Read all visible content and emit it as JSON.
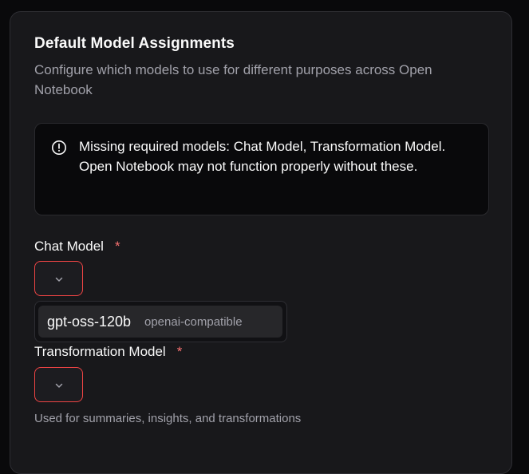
{
  "card": {
    "title": "Default Model Assignments",
    "subtitle": "Configure which models to use for different purposes across Open Notebook"
  },
  "alert": {
    "icon": "alert-circle-icon",
    "message": "Missing required models: Chat Model, Transformation Model. Open Notebook may not function properly without these."
  },
  "chat_model": {
    "label": "Chat Model",
    "required_marker": "*",
    "selected_value": "",
    "dropdown_open": true,
    "options": [
      {
        "name": "gpt-oss-120b",
        "provider": "openai-compatible"
      }
    ]
  },
  "transformation_model": {
    "label": "Transformation Model",
    "required_marker": "*",
    "selected_value": "",
    "help_text": "Used for summaries, insights, and transformations"
  },
  "colors": {
    "background": "#09090b",
    "card": "#18181b",
    "error_border": "#ef4444",
    "required_star": "#f87171",
    "muted_text": "#a1a1aa"
  }
}
